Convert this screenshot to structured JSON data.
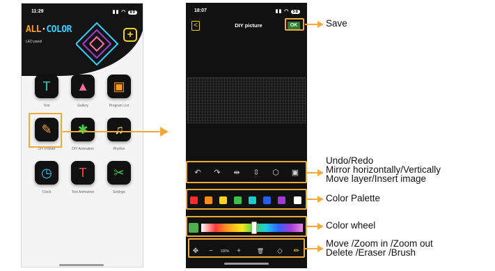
{
  "left_phone": {
    "status_time": "11:29",
    "battery": "80",
    "logo_parts": [
      "ALL",
      "·",
      "COLOR"
    ],
    "logo_sub": "LED panel",
    "add_label": "+",
    "apps": [
      {
        "label": "Text",
        "icon": "text-icon",
        "glyph": "T",
        "color": "#35d6c5"
      },
      {
        "label": "Gallery",
        "icon": "gallery-icon",
        "glyph": "▲",
        "color": "#ff6fa3"
      },
      {
        "label": "Program List",
        "icon": "program-list-icon",
        "glyph": "▣",
        "color": "#ff9b1d"
      },
      {
        "label": "DIY Picture",
        "icon": "diy-picture-icon",
        "glyph": "✎",
        "color": "#ff9b1d"
      },
      {
        "label": "DIY Animation",
        "icon": "diy-animation-icon",
        "glyph": "✱",
        "color": "#3fd24b"
      },
      {
        "label": "Rhythm",
        "icon": "rhythm-icon",
        "glyph": "♫",
        "color": "#ffe06b"
      },
      {
        "label": "Clock",
        "icon": "clock-icon",
        "glyph": "◷",
        "color": "#2fd2ff"
      },
      {
        "label": "Text Animation",
        "icon": "text-animation-icon",
        "glyph": "T",
        "color": "#ff4b4b"
      },
      {
        "label": "Settings",
        "icon": "settings-icon",
        "glyph": "✂",
        "color": "#3fd24b"
      }
    ]
  },
  "right_phone": {
    "status_time": "18:07",
    "battery": "58",
    "title": "DIY picture",
    "back_label": "<",
    "ok_label": "OK",
    "tools": [
      {
        "icon": "undo-icon",
        "glyph": "↶"
      },
      {
        "icon": "redo-icon",
        "glyph": "↷"
      },
      {
        "icon": "mirror-horizontal-icon",
        "glyph": "⇹"
      },
      {
        "icon": "mirror-vertical-icon",
        "glyph": "⇳"
      },
      {
        "icon": "move-layer-icon",
        "glyph": "⬡"
      },
      {
        "icon": "insert-image-icon",
        "glyph": "▣"
      }
    ],
    "palette": [
      "#ff2a2a",
      "#ff8c1a",
      "#ffd21a",
      "#3fbf4a",
      "#1fc9c9",
      "#2660e6",
      "#a23bd6",
      "#ffffff"
    ],
    "current_color": "#4caf50",
    "hue_position": 0.5,
    "bottom_tools": {
      "move_icon": "✥",
      "zoom_out": "−",
      "zoom_level": "100%",
      "zoom_in": "+",
      "delete_icon": "🗑",
      "eraser_icon": "◇",
      "brush_icon": "✏"
    }
  },
  "annotations": {
    "save": "Save",
    "undo_redo": "Undo/Redo",
    "mirror": "Mirror horizontally/Vertically",
    "move_insert": "Move layer/Insert image",
    "palette": "Color Palette",
    "wheel": "Color wheel",
    "move_zoom": "Move /Zoom in /Zoom out",
    "delete_brush": "Delete /Eraser /Brush"
  },
  "colors": {
    "accent": "#f2a93b",
    "brand_yellow": "#f4d21f",
    "ok_green": "#2e7d32"
  }
}
